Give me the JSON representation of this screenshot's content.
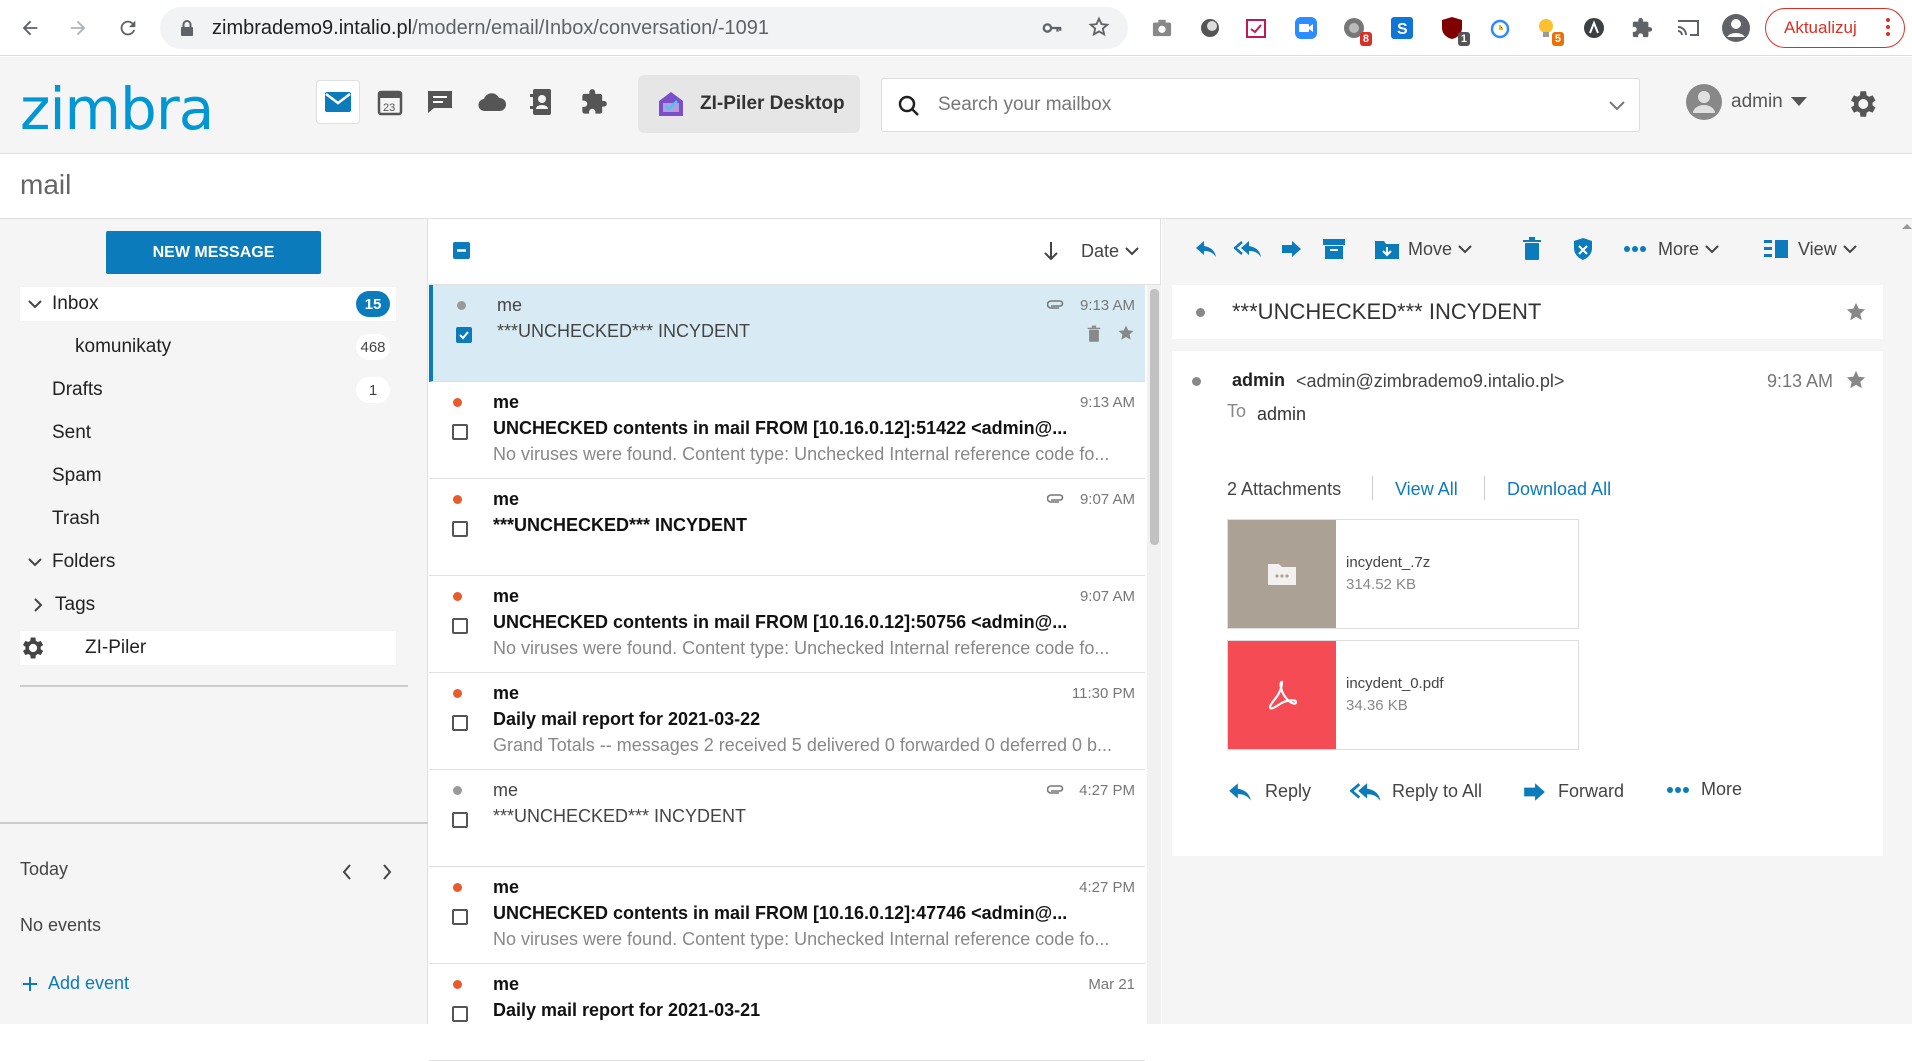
{
  "browser": {
    "url_host": "zimbrademo9.intalio.pl",
    "url_path": "/modern/email/Inbox/conversation/-1091",
    "ext_badges": [
      "8",
      "1",
      "5"
    ],
    "update_label": "Aktualizuj"
  },
  "header": {
    "logo": "zimbra",
    "calendar_day": "23",
    "app_button": "ZI-Piler Desktop",
    "search_placeholder": "Search your mailbox",
    "user": "admin"
  },
  "section_title": "mail",
  "sidebar": {
    "new_message": "NEW MESSAGE",
    "folders": [
      {
        "label": "Inbox",
        "count": "15"
      },
      {
        "label": "komunikaty",
        "count": "468"
      },
      {
        "label": "Drafts",
        "count": "1"
      },
      {
        "label": "Sent",
        "count": ""
      },
      {
        "label": "Spam",
        "count": ""
      },
      {
        "label": "Trash",
        "count": ""
      },
      {
        "label": "Folders",
        "count": ""
      },
      {
        "label": "Tags",
        "count": ""
      },
      {
        "label": "ZI-Piler",
        "count": ""
      }
    ],
    "calendar": {
      "day_label": "Today",
      "no_events": "No events",
      "add_event": "Add event"
    }
  },
  "list": {
    "sort_label": "Date",
    "messages": [
      {
        "from": "me",
        "subject": "***UNCHECKED*** INCYDENT",
        "preview": "",
        "time": "9:13 AM",
        "unread": false,
        "selected": true,
        "attachment": true
      },
      {
        "from": "me",
        "subject": "UNCHECKED contents in mail FROM [10.16.0.12]:51422 <admin@...",
        "preview": "No viruses were found. Content type: Unchecked Internal reference code fo...",
        "time": "9:13 AM",
        "unread": true,
        "selected": false,
        "attachment": false
      },
      {
        "from": "me",
        "subject": "***UNCHECKED*** INCYDENT",
        "preview": "",
        "time": "9:07 AM",
        "unread": true,
        "selected": false,
        "attachment": true
      },
      {
        "from": "me",
        "subject": "UNCHECKED contents in mail FROM [10.16.0.12]:50756 <admin@...",
        "preview": "No viruses were found. Content type: Unchecked Internal reference code fo...",
        "time": "9:07 AM",
        "unread": true,
        "selected": false,
        "attachment": false
      },
      {
        "from": "me",
        "subject": "Daily mail report for 2021-03-22",
        "preview": "Grand Totals -- messages 2 received 5 delivered 0 forwarded 0 deferred 0 b...",
        "time": "11:30 PM",
        "unread": true,
        "selected": false,
        "attachment": false
      },
      {
        "from": "me",
        "subject": "***UNCHECKED*** INCYDENT",
        "preview": "",
        "time": "4:27 PM",
        "unread": false,
        "selected": false,
        "attachment": true
      },
      {
        "from": "me",
        "subject": "UNCHECKED contents in mail FROM [10.16.0.12]:47746 <admin@...",
        "preview": "No viruses were found. Content type: Unchecked Internal reference code fo...",
        "time": "4:27 PM",
        "unread": true,
        "selected": false,
        "attachment": false
      },
      {
        "from": "me",
        "subject": "Daily mail report for 2021-03-21",
        "preview": "",
        "time": "Mar 21",
        "unread": true,
        "selected": false,
        "attachment": false
      }
    ]
  },
  "reader": {
    "toolbar": {
      "move": "Move",
      "more": "More",
      "view": "View"
    },
    "conversation_subject": "***UNCHECKED*** INCYDENT",
    "sender_name": "admin",
    "sender_email": "<admin@zimbrademo9.intalio.pl>",
    "time": "9:13 AM",
    "to_label": "To",
    "to_value": "admin",
    "attachments_label": "2 Attachments",
    "view_all": "View All",
    "download_all": "Download All",
    "attachments": [
      {
        "name": "incydent_.7z",
        "size": "314.52 KB",
        "color": "#aba194"
      },
      {
        "name": "incydent_0.pdf",
        "size": "34.36 KB",
        "color": "#f44b55"
      }
    ],
    "actions": {
      "reply": "Reply",
      "reply_all": "Reply to All",
      "forward": "Forward",
      "more": "More"
    }
  },
  "colors": {
    "accent": "#0b7bbc",
    "unread_dot": "#ea5a2b",
    "logo": "#0097d4"
  }
}
